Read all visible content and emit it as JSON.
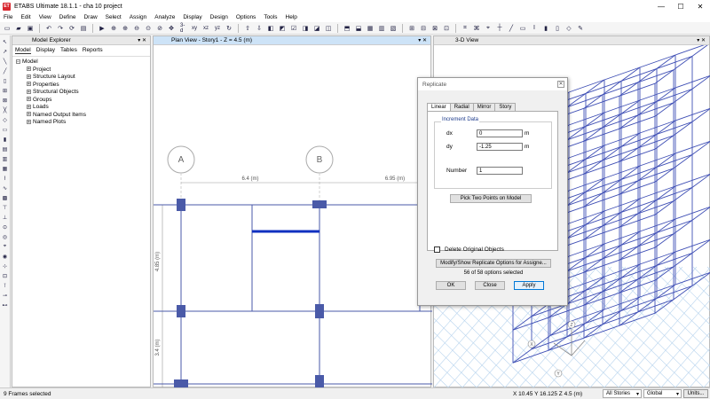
{
  "window": {
    "title": "ETABS Ultimate 18.1.1 - cha 10 project",
    "logo_text": "ET",
    "minimize": "—",
    "maximize": "☐",
    "close": "✕"
  },
  "menu": [
    "File",
    "Edit",
    "View",
    "Define",
    "Draw",
    "Select",
    "Assign",
    "Analyze",
    "Display",
    "Design",
    "Options",
    "Tools",
    "Help"
  ],
  "toolbar": {
    "view_3d_label": "3-d",
    "plan_label": "xy",
    "elev_label": "xz",
    "elev2_label": "yz"
  },
  "explorer": {
    "title": "Model Explorer",
    "tabs": [
      "Model",
      "Display",
      "Tables",
      "Reports"
    ],
    "root": "Model",
    "items": [
      "Project",
      "Structure Layout",
      "Properties",
      "Structural Objects",
      "Groups",
      "Loads",
      "Named Output Items",
      "Named Plots"
    ]
  },
  "plan_view": {
    "title": "Plan View - Story1 - Z = 4.5 (m)",
    "grid_a": "A",
    "grid_b": "B",
    "dim_ab": "6.4 (m)",
    "dim_bc": "6.95 (m)",
    "dim_v1": "4.85 (m)",
    "dim_v2": "3.4 (m)"
  },
  "view_3d": {
    "title": "3-D View",
    "axis_z": "Z",
    "axis_x": "X",
    "axis_y": "Y"
  },
  "replicate_dialog": {
    "title": "Replicate",
    "tabs": [
      "Linear",
      "Radial",
      "Mirror",
      "Story"
    ],
    "group_title": "Increment Data",
    "dx_label": "dx",
    "dx_value": "0",
    "dx_unit": "m",
    "dy_label": "dy",
    "dy_value": "-1.25",
    "dy_unit": "m",
    "number_label": "Number",
    "number_value": "1",
    "pick_button": "Pick Two Points on Model",
    "delete_label": "Delete Original Objects",
    "modify_button": "Modify/Show Replicate Options for Assigne...",
    "options_note": "56 of 58 options selected",
    "ok": "OK",
    "close": "Close",
    "apply": "Apply"
  },
  "status": {
    "left": "9 Frames selected",
    "coords": "X 10.45  Y 16.125  Z 4.5 (m)",
    "stories": "All Stories",
    "coord_sys": "Global",
    "units_button": "Units..."
  }
}
